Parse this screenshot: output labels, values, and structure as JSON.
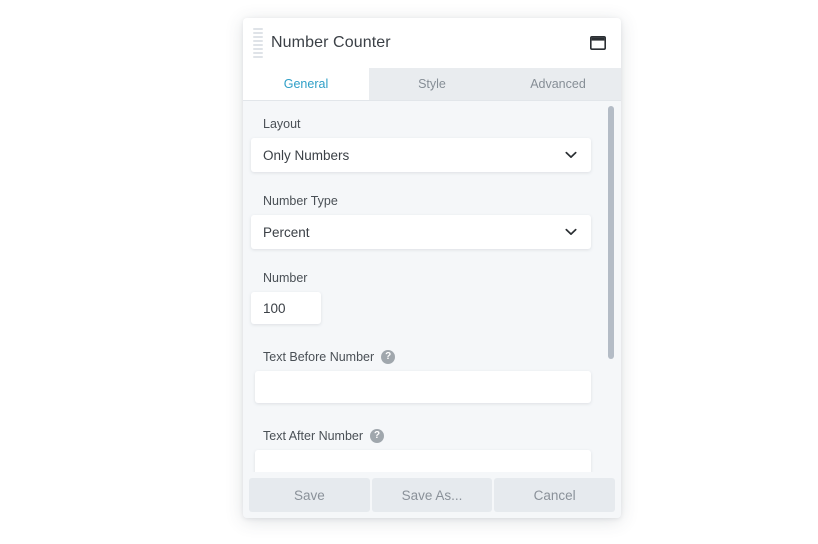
{
  "panel": {
    "title": "Number Counter",
    "drag_handle_icon": "drag-handle-icon",
    "window_icon": "window-restore-icon"
  },
  "tabs": [
    {
      "label": "General",
      "active": true
    },
    {
      "label": "Style",
      "active": false
    },
    {
      "label": "Advanced",
      "active": false
    }
  ],
  "fields": {
    "layout": {
      "label": "Layout",
      "value": "Only Numbers",
      "chevron_icon": "chevron-down-icon"
    },
    "number_type": {
      "label": "Number Type",
      "value": "Percent",
      "chevron_icon": "chevron-down-icon"
    },
    "number": {
      "label": "Number",
      "value": "100",
      "placeholder": ""
    },
    "text_before_number": {
      "label": "Text Before Number",
      "value": "",
      "placeholder": "",
      "help_icon": "?"
    },
    "text_after_number": {
      "label": "Text After Number",
      "value": "",
      "placeholder": "",
      "help_icon": "?"
    }
  },
  "footer": {
    "save_label": "Save",
    "save_as_label": "Save As...",
    "cancel_label": "Cancel"
  },
  "colors": {
    "accent": "#2f9fc7",
    "panel_bg": "#f5f7f9",
    "header_bg": "#ffffff",
    "tabbar_bg": "#e9ecef",
    "footer_button_bg": "#e6eaee",
    "footer_button_text": "#8a9199",
    "scrollbar_thumb": "#b4bcc6",
    "help_icon_bg": "#a0a7ad"
  }
}
